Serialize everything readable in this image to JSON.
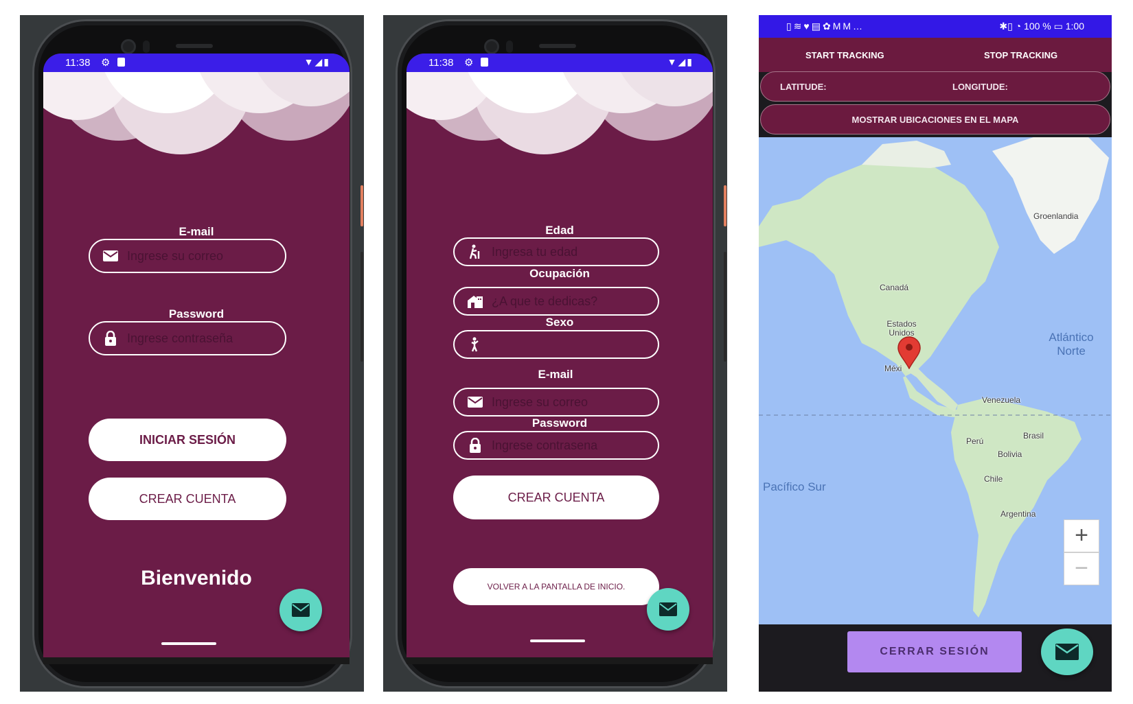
{
  "login": {
    "status_time": "11:38",
    "email_label": "E-mail",
    "email_placeholder": "Ingrese su correo",
    "password_label": "Password",
    "password_placeholder": "Ingrese contraseña",
    "login_button": "INICIAR SESIÓN",
    "create_button": "CREAR CUENTA",
    "welcome": "Bienvenido",
    "fab_icon": "mail-icon"
  },
  "register": {
    "status_time": "11:38",
    "age_label": "Edad",
    "age_placeholder": "Ingresa tu edad",
    "occupation_label": "Ocupación",
    "occupation_placeholder": "¿A que te dedicas?",
    "sex_label": "Sexo",
    "sex_value": "",
    "email_label": "E-mail",
    "email_placeholder": "Ingrese su correo",
    "password_label": "Password",
    "password_placeholder": "Ingrese contrasena",
    "create_button": "CREAR CUENTA",
    "back_button": "VOLVER A LA PANTALLA DE INICIO.",
    "fab_icon": "mail-icon"
  },
  "tracking": {
    "status_battery": "100 %",
    "status_time": "1:00",
    "start_button": "START TRACKING",
    "stop_button": "STOP TRACKING",
    "latitude_label": "LATITUDE:",
    "longitude_label": "LONGITUDE:",
    "show_map_button": "MOSTRAR UBICACIONES EN EL MAPA",
    "map_labels": {
      "greenland": "Groenlandia",
      "canada": "Canadá",
      "usa": "Estados Unidos",
      "mexico": "Méxi",
      "atlantic": "Atlántico Norte",
      "venezuela": "Venezuela",
      "peru": "Perú",
      "brasil": "Brasil",
      "bolivia": "Bolivia",
      "chile": "Chile",
      "argentina": "Argentina",
      "pacific": "Pacífico Sur"
    },
    "zoom_in": "+",
    "zoom_out": "−",
    "logout_button": "CERRAR SESIÓN",
    "fab_icon": "mail-icon"
  },
  "colors": {
    "app_background": "#6b1c47",
    "status_bar": "#3b1ee8",
    "fab": "#5fd6c2",
    "logout": "#b388f0",
    "map_water": "#9ec0f5",
    "map_land": "#cfe7c4"
  }
}
